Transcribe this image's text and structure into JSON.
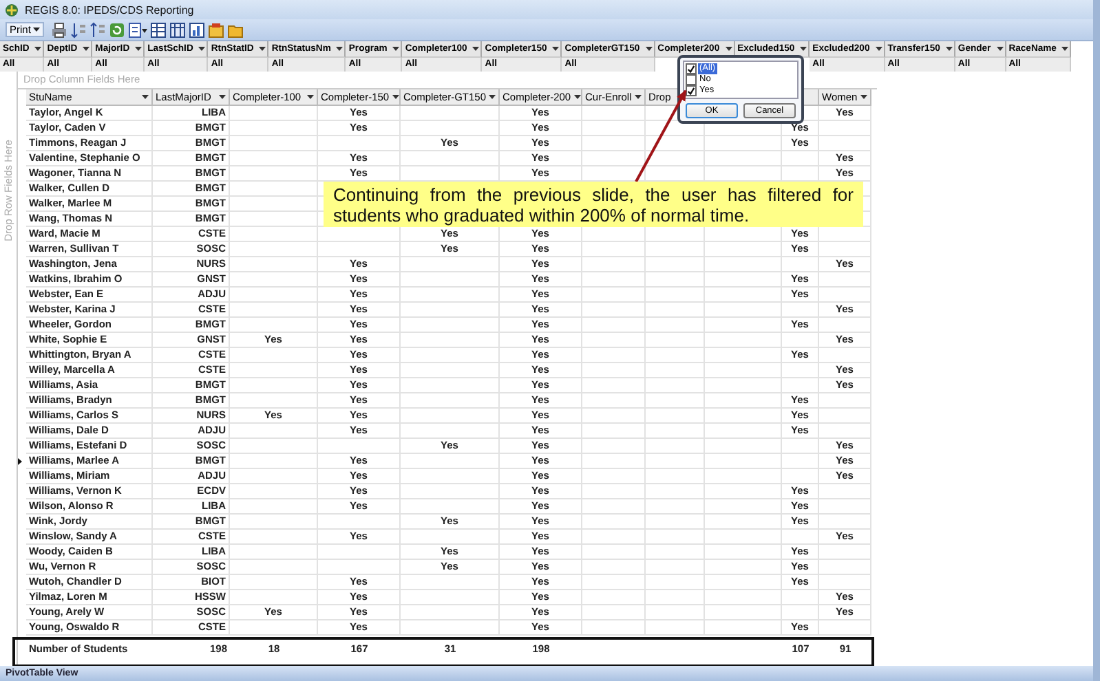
{
  "window": {
    "title": "REGIS 8.0: IPEDS/CDS Reporting"
  },
  "toolbar": {
    "print_button": "Print"
  },
  "filter_fields": [
    {
      "label": "SchID",
      "value": "All"
    },
    {
      "label": "DeptID",
      "value": "All"
    },
    {
      "label": "MajorID",
      "value": "All"
    },
    {
      "label": "LastSchID",
      "value": "All"
    },
    {
      "label": "RtnStatID",
      "value": "All"
    },
    {
      "label": "RtnStatusNm",
      "value": "All"
    },
    {
      "label": "Program",
      "value": "All"
    },
    {
      "label": "Completer100",
      "value": "All"
    },
    {
      "label": "Completer150",
      "value": "All"
    },
    {
      "label": "CompleterGT150",
      "value": "All"
    },
    {
      "label": "Completer200"
    },
    {
      "label": "Excluded150"
    },
    {
      "label": "Excluded200",
      "value": "All"
    },
    {
      "label": "Transfer150",
      "value": "All"
    },
    {
      "label": "Gender",
      "value": "All"
    },
    {
      "label": "RaceName",
      "value": "All"
    }
  ],
  "drop_column_hint": "Drop Column Fields Here",
  "drop_row_hint": "Drop Row Fields Here",
  "grid": {
    "columns": [
      "StuName",
      "LastMajorID",
      "Completer-100",
      "Completer-150",
      "Completer-GT150",
      "Completer-200",
      "Cur-Enroll",
      "Drop",
      null,
      null,
      "Women"
    ],
    "rows": [
      {
        "cells": [
          "Taylor, Angel K",
          "LIBA",
          null,
          "Yes",
          null,
          "Yes",
          null,
          null,
          null,
          null,
          "Yes"
        ],
        "selected": false
      },
      {
        "cells": [
          "Taylor, Caden V",
          "BMGT",
          null,
          "Yes",
          null,
          "Yes",
          null,
          null,
          null,
          "Yes",
          null
        ],
        "selected": false
      },
      {
        "cells": [
          "Timmons, Reagan J",
          "BMGT",
          null,
          null,
          "Yes",
          "Yes",
          null,
          null,
          null,
          "Yes",
          null
        ],
        "selected": false
      },
      {
        "cells": [
          "Valentine, Stephanie O",
          "BMGT",
          null,
          "Yes",
          null,
          "Yes",
          null,
          null,
          null,
          null,
          "Yes"
        ],
        "selected": false
      },
      {
        "cells": [
          "Wagoner, Tianna N",
          "BMGT",
          null,
          "Yes",
          null,
          "Yes",
          null,
          null,
          null,
          null,
          "Yes"
        ],
        "selected": false
      },
      {
        "cells": [
          "Walker, Cullen D",
          "BMGT",
          null,
          null,
          null,
          null,
          null,
          null,
          null,
          null,
          null
        ],
        "selected": false
      },
      {
        "cells": [
          "Walker, Marlee M",
          "BMGT",
          null,
          null,
          null,
          null,
          null,
          null,
          null,
          null,
          null
        ],
        "selected": false
      },
      {
        "cells": [
          "Wang, Thomas N",
          "BMGT",
          null,
          null,
          null,
          null,
          null,
          null,
          null,
          null,
          null
        ],
        "selected": false
      },
      {
        "cells": [
          "Ward, Macie M",
          "CSTE",
          null,
          null,
          "Yes",
          "Yes",
          null,
          null,
          null,
          "Yes",
          null
        ],
        "selected": false
      },
      {
        "cells": [
          "Warren, Sullivan T",
          "SOSC",
          null,
          null,
          "Yes",
          "Yes",
          null,
          null,
          null,
          "Yes",
          null
        ],
        "selected": false
      },
      {
        "cells": [
          "Washington, Jena",
          "NURS",
          null,
          "Yes",
          null,
          "Yes",
          null,
          null,
          null,
          null,
          "Yes"
        ],
        "selected": false
      },
      {
        "cells": [
          "Watkins, Ibrahim O",
          "GNST",
          null,
          "Yes",
          null,
          "Yes",
          null,
          null,
          null,
          "Yes",
          null
        ],
        "selected": false
      },
      {
        "cells": [
          "Webster, Ean E",
          "ADJU",
          null,
          "Yes",
          null,
          "Yes",
          null,
          null,
          null,
          "Yes",
          null
        ],
        "selected": false
      },
      {
        "cells": [
          "Webster, Karina J",
          "CSTE",
          null,
          "Yes",
          null,
          "Yes",
          null,
          null,
          null,
          null,
          "Yes"
        ],
        "selected": false
      },
      {
        "cells": [
          "Wheeler, Gordon",
          "BMGT",
          null,
          "Yes",
          null,
          "Yes",
          null,
          null,
          null,
          "Yes",
          null
        ],
        "selected": false
      },
      {
        "cells": [
          "White, Sophie E",
          "GNST",
          "Yes",
          "Yes",
          null,
          "Yes",
          null,
          null,
          null,
          null,
          "Yes"
        ],
        "selected": false
      },
      {
        "cells": [
          "Whittington, Bryan A",
          "CSTE",
          null,
          "Yes",
          null,
          "Yes",
          null,
          null,
          null,
          "Yes",
          null
        ],
        "selected": false
      },
      {
        "cells": [
          "Willey, Marcella A",
          "CSTE",
          null,
          "Yes",
          null,
          "Yes",
          null,
          null,
          null,
          null,
          "Yes"
        ],
        "selected": false
      },
      {
        "cells": [
          "Williams, Asia",
          "BMGT",
          null,
          "Yes",
          null,
          "Yes",
          null,
          null,
          null,
          null,
          "Yes"
        ],
        "selected": false
      },
      {
        "cells": [
          "Williams, Bradyn",
          "BMGT",
          null,
          "Yes",
          null,
          "Yes",
          null,
          null,
          null,
          "Yes",
          null
        ],
        "selected": false
      },
      {
        "cells": [
          "Williams, Carlos S",
          "NURS",
          "Yes",
          "Yes",
          null,
          "Yes",
          null,
          null,
          null,
          "Yes",
          null
        ],
        "selected": false
      },
      {
        "cells": [
          "Williams, Dale D",
          "ADJU",
          null,
          "Yes",
          null,
          "Yes",
          null,
          null,
          null,
          "Yes",
          null
        ],
        "selected": false
      },
      {
        "cells": [
          "Williams, Estefani D",
          "SOSC",
          null,
          null,
          "Yes",
          "Yes",
          null,
          null,
          null,
          null,
          "Yes"
        ],
        "selected": false
      },
      {
        "cells": [
          "Williams, Marlee A",
          "BMGT",
          null,
          "Yes",
          null,
          "Yes",
          null,
          null,
          null,
          null,
          "Yes"
        ],
        "selected": true
      },
      {
        "cells": [
          "Williams, Miriam",
          "ADJU",
          null,
          "Yes",
          null,
          "Yes",
          null,
          null,
          null,
          null,
          "Yes"
        ],
        "selected": false
      },
      {
        "cells": [
          "Williams, Vernon K",
          "ECDV",
          null,
          "Yes",
          null,
          "Yes",
          null,
          null,
          null,
          "Yes",
          null
        ],
        "selected": false
      },
      {
        "cells": [
          "Wilson, Alonso R",
          "LIBA",
          null,
          "Yes",
          null,
          "Yes",
          null,
          null,
          null,
          "Yes",
          null
        ],
        "selected": false
      },
      {
        "cells": [
          "Wink, Jordy",
          "BMGT",
          null,
          null,
          "Yes",
          "Yes",
          null,
          null,
          null,
          "Yes",
          null
        ],
        "selected": false
      },
      {
        "cells": [
          "Winslow, Sandy A",
          "CSTE",
          null,
          "Yes",
          null,
          "Yes",
          null,
          null,
          null,
          null,
          "Yes"
        ],
        "selected": false
      },
      {
        "cells": [
          "Woody, Caiden B",
          "LIBA",
          null,
          null,
          "Yes",
          "Yes",
          null,
          null,
          null,
          "Yes",
          null
        ],
        "selected": false
      },
      {
        "cells": [
          "Wu, Vernon R",
          "SOSC",
          null,
          null,
          "Yes",
          "Yes",
          null,
          null,
          null,
          "Yes",
          null
        ],
        "selected": false
      },
      {
        "cells": [
          "Wutoh, Chandler D",
          "BIOT",
          null,
          "Yes",
          null,
          "Yes",
          null,
          null,
          null,
          "Yes",
          null
        ],
        "selected": false
      },
      {
        "cells": [
          "Yilmaz, Loren M",
          "HSSW",
          null,
          "Yes",
          null,
          "Yes",
          null,
          null,
          null,
          null,
          "Yes"
        ],
        "selected": false
      },
      {
        "cells": [
          "Young, Arely W",
          "SOSC",
          "Yes",
          "Yes",
          null,
          "Yes",
          null,
          null,
          null,
          null,
          "Yes"
        ],
        "selected": false
      },
      {
        "cells": [
          "Young, Oswaldo R",
          "CSTE",
          null,
          "Yes",
          null,
          "Yes",
          null,
          null,
          null,
          "Yes",
          null
        ],
        "selected": false
      }
    ],
    "totals": {
      "cells": [
        "Number of Students",
        "198",
        "18",
        "167",
        "31",
        "198",
        null,
        null,
        null,
        "107",
        "91"
      ]
    }
  },
  "filter_popup": {
    "items": [
      {
        "label": "(All)",
        "checked": true,
        "selected": true
      },
      {
        "label": "No",
        "checked": false,
        "selected": false
      },
      {
        "label": "Yes",
        "checked": true,
        "selected": false
      }
    ],
    "buttons": [
      "OK",
      "Cancel"
    ]
  },
  "callout": {
    "text": "Continuing from the previous slide, the user has filtered for students who graduated within 200% of normal time."
  },
  "status_bar": {
    "text": "PivotTable View"
  }
}
